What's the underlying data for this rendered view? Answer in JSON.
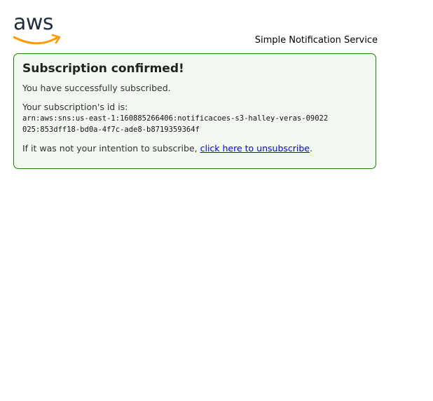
{
  "brand": {
    "logo_text": "aws",
    "service_name": "Simple Notification Service",
    "smile_color": "#ff9900",
    "text_color": "#232f3e"
  },
  "message": {
    "title": "Subscription confirmed!",
    "success_text": "You have successfully subscribed.",
    "id_label": "Your subscription's id is:",
    "subscription_arn": "arn:aws:sns:us-east-1:160885266406:notificacoes-s3-halley-veras-09022025:853dff18-bd0a-4f7c-ade8-b8719359364f",
    "unsubscribe_prefix": "If it was not your intention to subscribe, ",
    "unsubscribe_link": "click here to unsubscribe",
    "unsubscribe_suffix": "."
  },
  "colors": {
    "card_border": "#1d8102",
    "card_background": "#f2f8f0",
    "link": "#0000ee"
  }
}
